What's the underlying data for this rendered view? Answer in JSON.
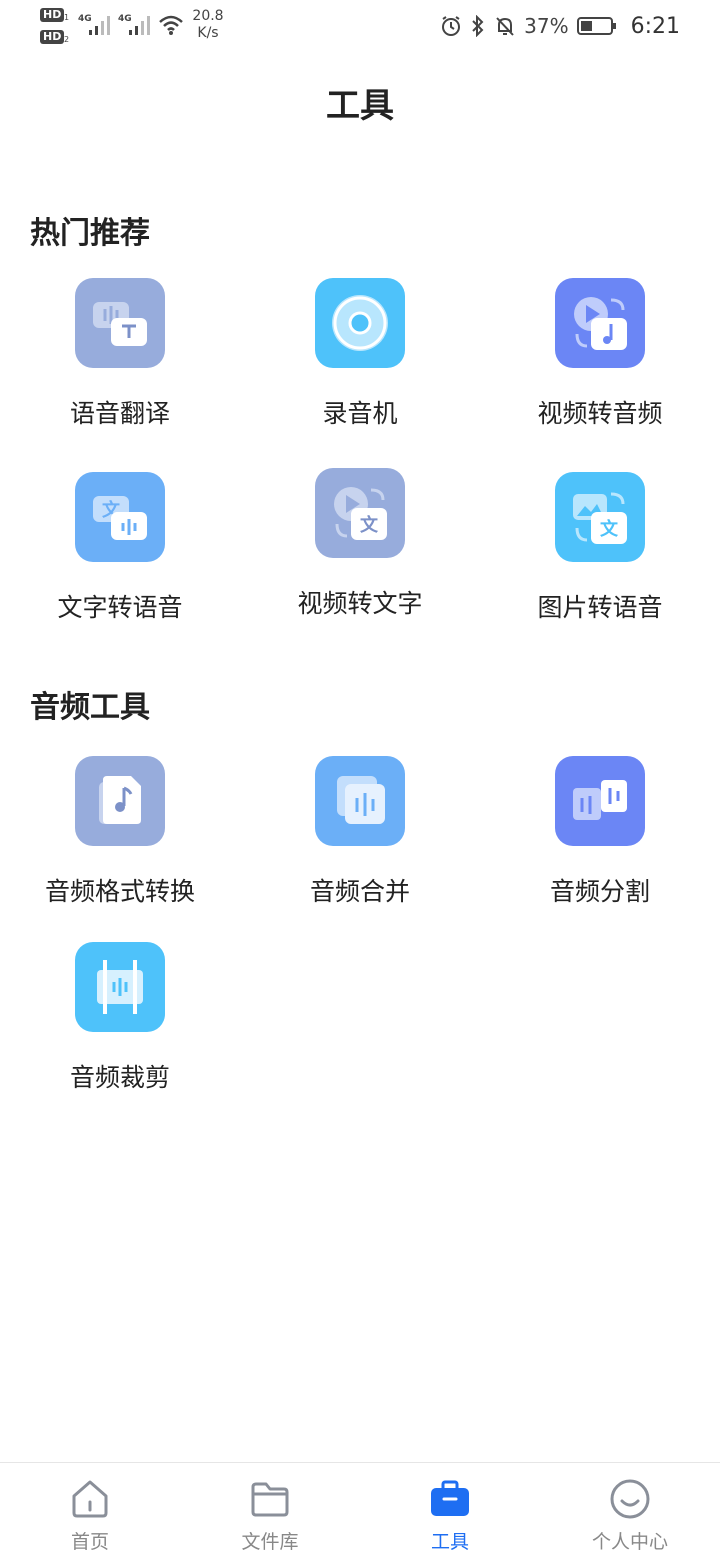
{
  "status_bar": {
    "hd1": "HD",
    "hd1_sub": "1",
    "hd2": "HD",
    "hd2_sub": "2",
    "net1": "4G",
    "net2": "4G",
    "speed_value": "20.8",
    "speed_unit": "K/s",
    "battery_pct": "37%",
    "time": "6:21"
  },
  "header": {
    "title": "工具"
  },
  "sections": {
    "hot": {
      "title": "热门推荐",
      "items": [
        {
          "label": "语音翻译",
          "icon": "voice-translate-icon",
          "color": "#97ACDC"
        },
        {
          "label": "录音机",
          "icon": "recorder-icon",
          "color": "#4EC2FA"
        },
        {
          "label": "视频转音频",
          "icon": "video-to-audio-icon",
          "color": "#6B86F5"
        },
        {
          "label": "文字转语音",
          "icon": "text-to-speech-icon",
          "color": "#6BAFF7"
        },
        {
          "label": "视频转文字",
          "icon": "video-to-text-icon",
          "color": "#97ACDC"
        },
        {
          "label": "图片转语音",
          "icon": "image-to-speech-icon",
          "color": "#4EC2FA"
        }
      ]
    },
    "audio": {
      "title": "音频工具",
      "items": [
        {
          "label": "音频格式转换",
          "icon": "audio-format-convert-icon",
          "color": "#97ACDC"
        },
        {
          "label": "音频合并",
          "icon": "audio-merge-icon",
          "color": "#6BAFF7"
        },
        {
          "label": "音频分割",
          "icon": "audio-split-icon",
          "color": "#6B86F5"
        },
        {
          "label": "音频裁剪",
          "icon": "audio-trim-icon",
          "color": "#4EC2FA"
        }
      ]
    }
  },
  "bottom_nav": {
    "active_color": "#1E6EF2",
    "items": [
      {
        "label": "首页",
        "icon": "home-icon"
      },
      {
        "label": "文件库",
        "icon": "folder-icon"
      },
      {
        "label": "工具",
        "icon": "toolbox-icon"
      },
      {
        "label": "个人中心",
        "icon": "profile-smile-icon"
      }
    ]
  }
}
